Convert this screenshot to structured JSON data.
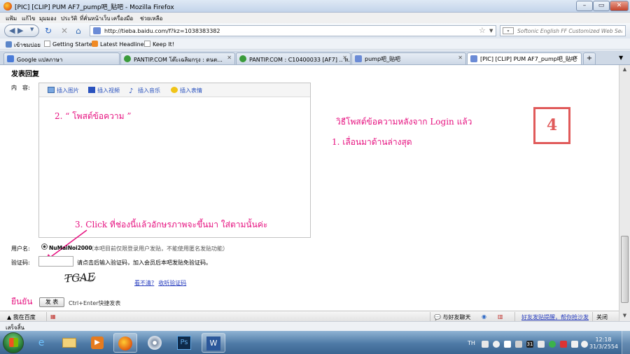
{
  "window": {
    "title": "[PIC] [CLIP] PUM AF7_pump吧_贴吧 - Mozilla Firefox"
  },
  "menu": [
    "แฟ้ม",
    "แก้ไข",
    "มุมมอง",
    "ประวัติ",
    "ที่คั่นหน้าเว็บ",
    "เครื่องมือ",
    "ช่วยเหลือ"
  ],
  "nav": {
    "url": "http://tieba.baidu.com/f?kz=1038383382",
    "search_placeholder": "Softonic English FF Customized Web Sea"
  },
  "bookmarks": [
    "เข้าชมบ่อย",
    "Getting Started",
    "Latest Headlines",
    "Keep It!"
  ],
  "tabs": [
    {
      "label": "Google แปลภาษา",
      "active": false
    },
    {
      "label": "PANTIP.COM โต๊ะเฉลิมกรุง : ดนต...",
      "active": false
    },
    {
      "label": "PANTIP.COM : C10400033 [AF7] .. ห...",
      "active": false
    },
    {
      "label": "pump吧_贴吧",
      "active": false
    },
    {
      "label": "[PIC] [CLIP] PUM AF7_pump吧_贴吧",
      "active": true
    }
  ],
  "page": {
    "section_title": "发表回复",
    "content_label": "内　容:",
    "toolbar": [
      "插入图片",
      "插入视频",
      "插入音乐",
      "插入表情"
    ],
    "username_label": "用户名:",
    "username_value": "NuMaiNoi2000",
    "username_note": "（本吧目前仅限登录用户发贴，不能使用匿名发贴功能）",
    "captcha_label": "验证码:",
    "captcha_hint": "请点击后输入验证码，加入会员后本吧发贴免验证码。",
    "captcha_text": "TGAE",
    "captcha_links": [
      "看不清?",
      "收听验证码"
    ],
    "submit_label": "发 表",
    "submit_hint": "Ctrl+Enter快捷发表"
  },
  "annotations": {
    "step2": "2. “ โพสต์ข้อความ ”",
    "main": "วิธีโพสต์ข้อความหลังจาก Login แล้ว",
    "step1": "1. เลื่อนมาด้านล่างสุด",
    "step3": "3. Click ที่ช่องนี้แล้วอักษรภาพจะขึ้นมา ใส่ตามนั้นค่ะ",
    "confirm": "ยืนยัน",
    "step_number": "4",
    "accent_color": "#e6107f",
    "box_color": "#e05a5a"
  },
  "baidu_bar": {
    "left": "我在百度",
    "chat": "与好友聊天",
    "notify": "好友发贴提醒，帮你抢沙发",
    "close": "关闭"
  },
  "status": {
    "text": "เสร็จสิ้น"
  },
  "taskbar": {
    "apps": [
      "internet-explorer-icon",
      "folder-icon",
      "media-player-icon",
      "firefox-icon",
      "disc-icon",
      "photoshop-icon",
      "word-icon"
    ],
    "lang": "TH",
    "time": "12:18",
    "date": "31/3/2554"
  }
}
